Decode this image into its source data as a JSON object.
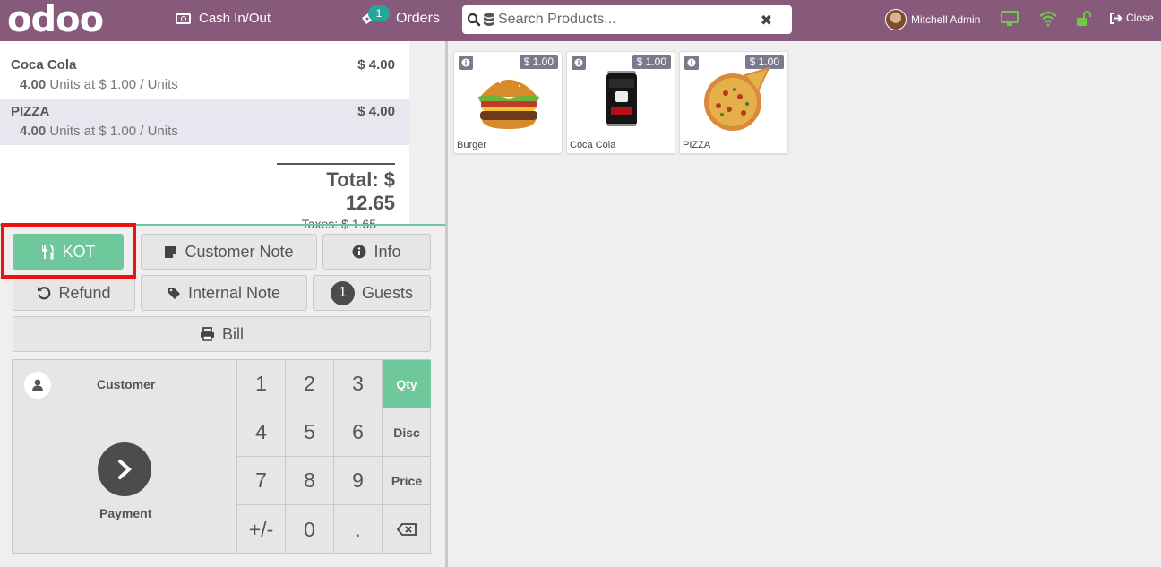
{
  "topbar": {
    "logo": "odoo",
    "cash_label": "Cash In/Out",
    "orders_badge": "1",
    "orders_label": "Orders",
    "search_placeholder": "Search Products...",
    "user_name": "Mitchell Admin",
    "close_label": "Close"
  },
  "order": {
    "lines": [
      {
        "name": "Coca Cola",
        "price": "$ 4.00",
        "qty": "4.00",
        "unit_info": "Units at $ 1.00 / Units"
      },
      {
        "name": "PIZZA",
        "price": "$ 4.00",
        "qty": "4.00",
        "unit_info": "Units at $ 1.00 / Units"
      }
    ],
    "total": "Total: $ 12.65",
    "taxes": "Taxes: $ 1.65"
  },
  "controls": {
    "kot": "KOT",
    "customer_note": "Customer Note",
    "info": "Info",
    "refund": "Refund",
    "internal_note": "Internal Note",
    "guests_count": "1",
    "guests": "Guests",
    "bill": "Bill"
  },
  "numpad": {
    "customer": "Customer",
    "payment": "Payment",
    "keys": [
      "1",
      "2",
      "3",
      "4",
      "5",
      "6",
      "7",
      "8",
      "9",
      "+/-",
      "0",
      "."
    ],
    "modes": [
      "Qty",
      "Disc",
      "Price"
    ],
    "active_mode": "Qty"
  },
  "products": [
    {
      "name": "Burger",
      "price": "$ 1.00"
    },
    {
      "name": "Coca Cola",
      "price": "$ 1.00"
    },
    {
      "name": "PIZZA",
      "price": "$ 1.00"
    }
  ],
  "colors": {
    "topbar": "#875a7b",
    "accent_green": "#6ec89b",
    "highlight_red": "#ee1111"
  }
}
